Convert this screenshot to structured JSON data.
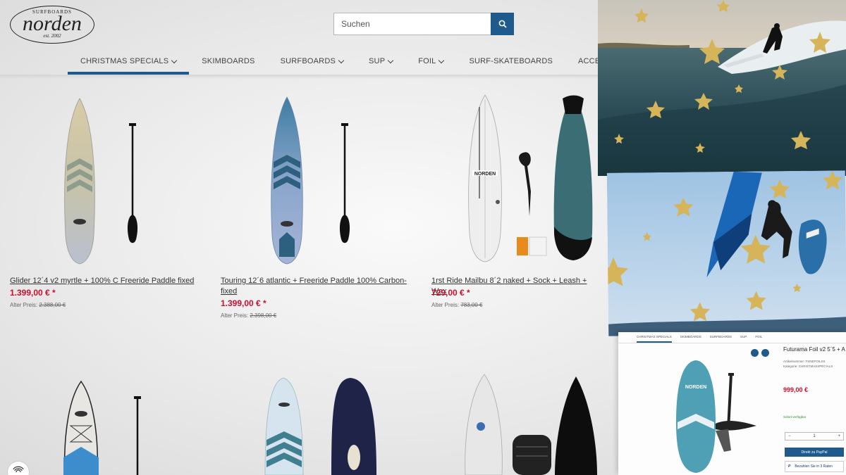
{
  "brand": {
    "top": "SURFBOARDS",
    "name": "norden",
    "est": "est. 2002"
  },
  "search": {
    "placeholder": "Suchen",
    "icon": "search-icon"
  },
  "nav": {
    "items": [
      {
        "label": "CHRISTMAS SPECIALS",
        "has_dropdown": true,
        "active": true
      },
      {
        "label": "SKIMBOARDS",
        "has_dropdown": false,
        "active": false
      },
      {
        "label": "SURFBOARDS",
        "has_dropdown": true,
        "active": false
      },
      {
        "label": "SUP",
        "has_dropdown": true,
        "active": false
      },
      {
        "label": "FOIL",
        "has_dropdown": true,
        "active": false
      },
      {
        "label": "SURF-SKATEBOARDS",
        "has_dropdown": false,
        "active": false
      },
      {
        "label": "ACCESSOIRES",
        "has_dropdown": true,
        "active": false
      }
    ],
    "accent": "#1e5a8c"
  },
  "products": [
    {
      "title": "Glider 12´4 v2 myrtle + 100% C Freeride Paddle fixed",
      "price": "1.399,00 € *",
      "old_label": "Alter Preis:",
      "old_price": "2.388,00 €"
    },
    {
      "title": "Touring 12´6 atlantic + Freeride Paddle 100% Carbon-fixed",
      "price": "1.399,00 € *",
      "old_label": "Alter Preis:",
      "old_price": "2.398,00 €"
    },
    {
      "title": "1rst Ride Mailbu 8´2 naked + Sock + Leash + Wax",
      "price": "729,00 € *",
      "old_label": "Alter Preis:",
      "old_price": "783,00 €"
    }
  ],
  "detail_screenshot": {
    "nav": [
      "CHRISTMAS SPECIALS",
      "SKIMBOARDS",
      "SURFBOARDS",
      "SUP",
      "FOIL"
    ],
    "title": "Futurama Foil v2 5´5 + A",
    "meta_1": "Artikelnummer: FSNEFOILSS",
    "meta_2": "Kategorie: CHRISTMASSPECIALS",
    "price": "999,00 €",
    "stock": "Sofort verfügbar",
    "qty": "1",
    "paypal_button": "Direkt zu PayPal",
    "paypal_later": "Bezahlen Sie in 3 Raten"
  },
  "colors": {
    "price_red": "#c8102e",
    "accent_blue": "#1e5a8c"
  }
}
